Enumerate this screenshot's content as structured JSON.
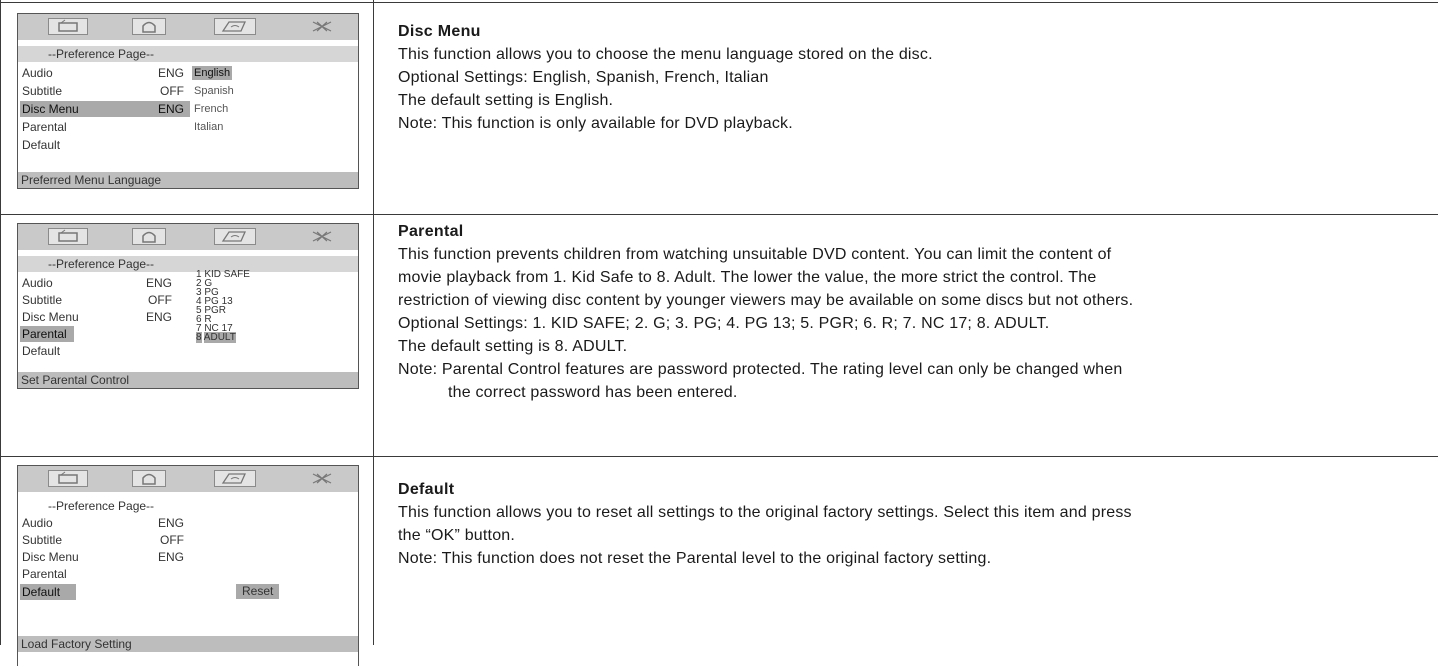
{
  "sections": [
    {
      "id": "disc-menu",
      "heading": "Disc Menu",
      "lines": [
        "This function allows you to choose the menu language stored on the disc.",
        "Optional Settings: English, Spanish, French, Italian",
        "The default setting is English.",
        "Note: This function is only available for DVD playback."
      ],
      "osd": {
        "icons": [
          "speaker-icon",
          "lock-icon",
          "tools-icon",
          "exit-icon"
        ],
        "title": "--Preference Page--",
        "items": [
          {
            "label": "Audio",
            "value": "ENG"
          },
          {
            "label": "Subtitle",
            "value": "OFF"
          },
          {
            "label": "Disc Menu",
            "value": "ENG",
            "selected": true
          },
          {
            "label": "Parental",
            "value": ""
          },
          {
            "label": "Default",
            "value": ""
          }
        ],
        "options": [
          "English",
          "Spanish",
          "French",
          "Italian"
        ],
        "selected_option": "English",
        "footer": "Preferred Menu Language"
      }
    },
    {
      "id": "parental",
      "heading": "Parental",
      "lines": [
        "This function prevents children from watching unsuitable DVD content. You can limit the content of",
        "movie playback from 1. Kid Safe to 8. Adult. The lower the value, the more strict the control. The",
        "restriction of viewing disc content by younger viewers may be available on some discs but not others.",
        "Optional Settings: 1. KID SAFE;  2. G;  3. PG;  4. PG 13;  5. PGR;  6. R;  7. NC 17;  8. ADULT.",
        "The default setting is 8.  ADULT."
      ],
      "note_line1": "Note: Parental Control features are password protected. The rating level can only be changed when",
      "note_line2": "the correct password has been entered.",
      "osd": {
        "title": "--Preference Page--",
        "items": [
          {
            "label": "Audio",
            "value": "ENG"
          },
          {
            "label": "Subtitle",
            "value": "OFF"
          },
          {
            "label": "Disc Menu",
            "value": "ENG"
          },
          {
            "label": "Parental",
            "value": "",
            "selected": true
          },
          {
            "label": "Default",
            "value": ""
          }
        ],
        "ratings": [
          "1  KID SAFE",
          "2  G",
          "3  PG",
          "4  PG  13",
          "5  PGR",
          "6  R",
          "7  NC 17",
          "8"
        ],
        "selected_rating": "ADULT",
        "footer": "Set Parental Control"
      }
    },
    {
      "id": "default",
      "heading": "Default",
      "lines": [
        "This function allows you to reset all settings to the original factory settings. Select this item and press",
        "the “OK” button.",
        "Note: This function does not reset the Parental level to the original factory setting."
      ],
      "osd": {
        "title": "--Preference Page--",
        "items": [
          {
            "label": "Audio",
            "value": "ENG"
          },
          {
            "label": "Subtitle",
            "value": "OFF"
          },
          {
            "label": "Disc Menu",
            "value": "ENG"
          },
          {
            "label": "Parental",
            "value": ""
          },
          {
            "label": "Default",
            "value": "",
            "selected": true
          }
        ],
        "reset_label": "Reset",
        "footer": "Load Factory Setting"
      }
    }
  ]
}
